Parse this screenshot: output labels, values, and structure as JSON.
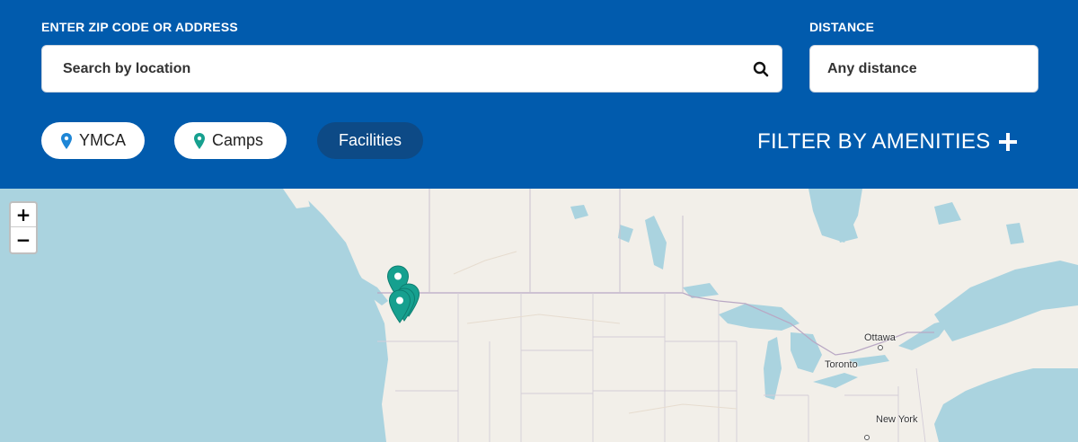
{
  "search": {
    "location_label": "ENTER ZIP CODE OR ADDRESS",
    "location_placeholder": "Search by location",
    "location_value": "",
    "distance_label": "DISTANCE",
    "distance_value": "Any distance"
  },
  "filters": {
    "chips": [
      {
        "label": "YMCA",
        "icon": "map-pin-icon",
        "pin_color": "#1e86d6",
        "active": false
      },
      {
        "label": "Camps",
        "icon": "map-pin-icon",
        "pin_color": "#16a08f",
        "active": false
      },
      {
        "label": "Facilities",
        "active": true
      }
    ],
    "amenities_label": "FILTER BY AMENITIES",
    "amenities_icon": "plus-icon"
  },
  "map": {
    "zoom_in": "+",
    "zoom_out": "−",
    "cities": [
      "Ottawa",
      "Toronto",
      "New York"
    ],
    "marker_color": "#16a08f",
    "marker_count": 4
  },
  "colors": {
    "header_bg": "#015bad",
    "active_chip_bg": "#0d4a86",
    "water": "#aad3df",
    "land": "#f2efe9"
  }
}
